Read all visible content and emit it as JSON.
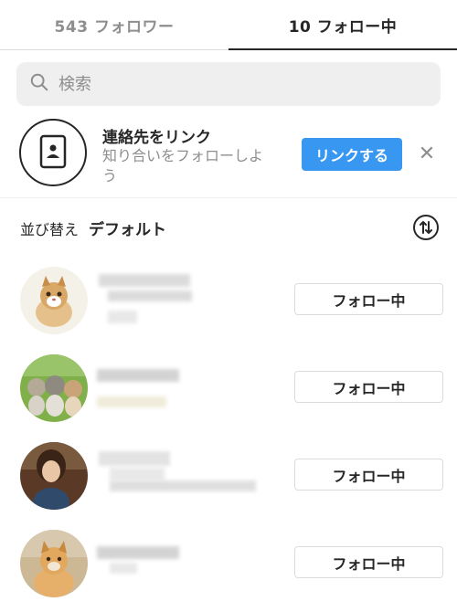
{
  "tabs": {
    "followers_label": "543 フォロワー",
    "following_label": "10 フォロー中"
  },
  "search": {
    "placeholder": "検索",
    "icon": "search-icon"
  },
  "contacts": {
    "title": "連絡先をリンク",
    "description": "知り合いをフォローしよう",
    "link_button": "リンクする",
    "close_icon": "close-icon",
    "icon": "contacts-book-icon"
  },
  "sort": {
    "label": "並び替え",
    "value": "デフォルト",
    "icon": "sort-arrows-icon"
  },
  "users": [
    {
      "follow_label": "フォロー中",
      "avatar": "kitten-avatar"
    },
    {
      "follow_label": "フォロー中",
      "avatar": "three-kittens-avatar"
    },
    {
      "follow_label": "フォロー中",
      "avatar": "person-avatar"
    },
    {
      "follow_label": "フォロー中",
      "avatar": "cat-avatar"
    }
  ],
  "colors": {
    "accent": "#3897f0",
    "text": "#262626",
    "muted": "#8e8e8e",
    "border": "#dbdbdb"
  }
}
